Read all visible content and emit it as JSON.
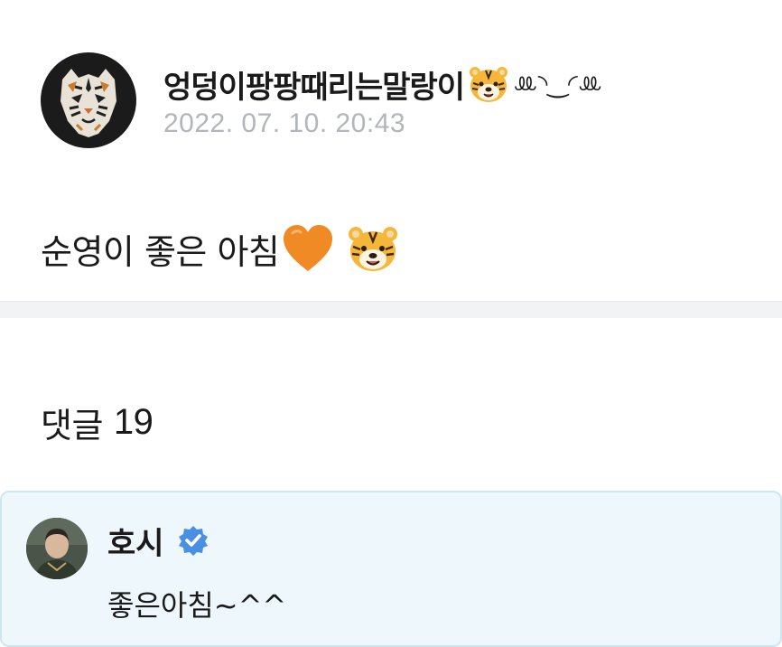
{
  "post": {
    "author_name": "엉덩이팡팡때리는말랑이",
    "author_emoji": "tiger-face-emoji",
    "author_kaomoji": "ꔛ◝‿◜ꔛ",
    "date": "2022. 07. 10. 20:43",
    "text": "순영이 좋은 아침",
    "text_emojis": [
      "orange-heart-emoji",
      "tiger-face-emoji"
    ]
  },
  "comments": {
    "heading_label": "댓글",
    "count": "19",
    "items": [
      {
        "author": "호시",
        "verified": true,
        "text": "좋은아침~^^"
      }
    ]
  },
  "colors": {
    "date_text": "#b2b5ba",
    "divider": "#f2f3f5",
    "comment_bg": "#eef7fb",
    "comment_border": "#cfe6ee",
    "verified_badge": "#4a90e2",
    "orange_heart": "#f08a24"
  }
}
